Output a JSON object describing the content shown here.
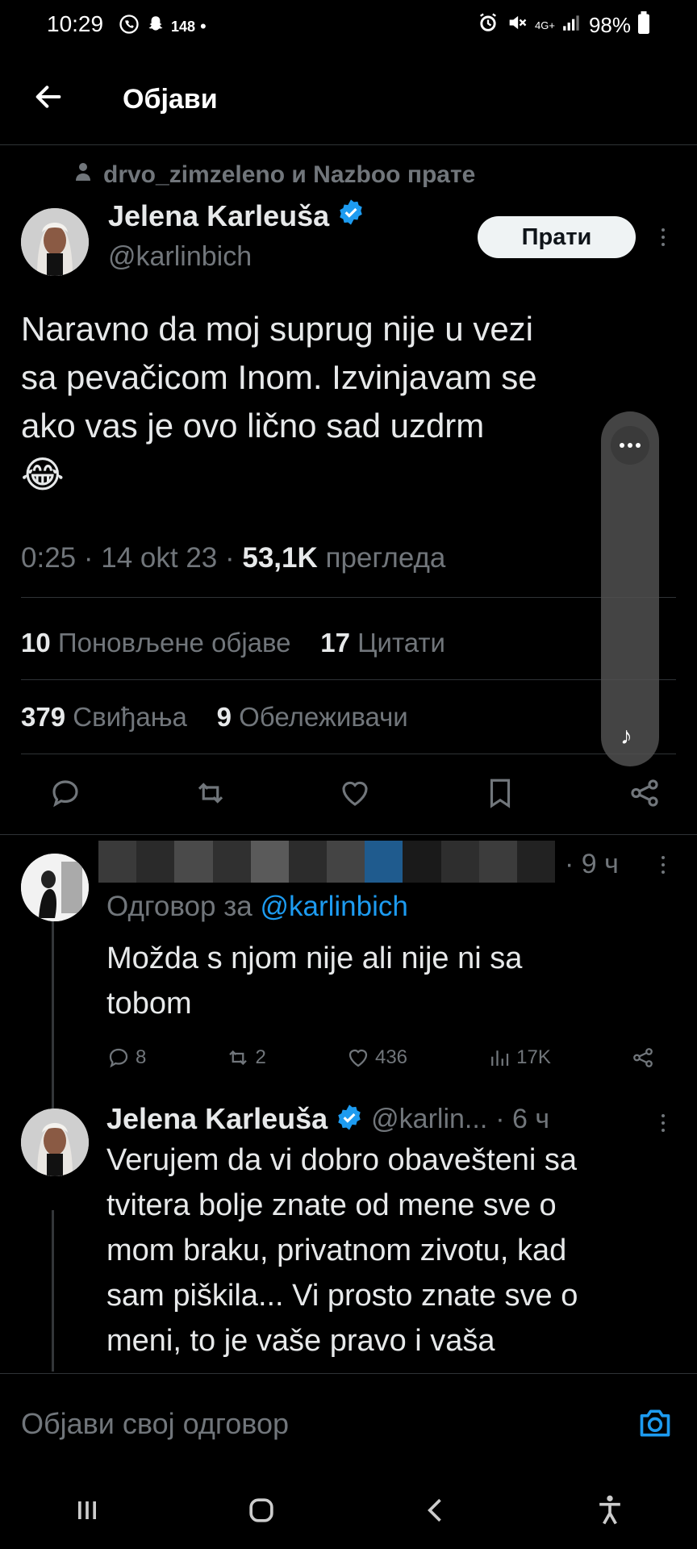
{
  "status_bar": {
    "time": "10:29",
    "notif_count": "148",
    "signal_label": "4G+",
    "battery": "98%"
  },
  "header": {
    "title": "Објави"
  },
  "tweet": {
    "social_context": "drvo_zimzeleno и Nazboo прате",
    "author_name": "Jelena Karleuša",
    "author_handle": "@karlinbich",
    "follow_label": "Прати",
    "text_lines": [
      "Naravno da moj suprug nije u vezi",
      "sa pevačicom Inom. Izvinjavam se",
      "ako vas je ovo lično sad uzdrm",
      "😂"
    ],
    "time": "0:25",
    "date": "14 okt 23",
    "views_count": "53,1K",
    "views_label": "прегледа",
    "reposts_count": "10",
    "reposts_label": "Поновљене објаве",
    "quotes_count": "17",
    "quotes_label": "Цитати",
    "likes_count": "379",
    "likes_label": "Свиђања",
    "bookmarks_count": "9",
    "bookmarks_label": "Обележивачи"
  },
  "reply1": {
    "time_ago": "· 9 ч",
    "reply_to_label": "Одговор за",
    "reply_to_handle": "@karlinbich",
    "text_lines": [
      "Možda s njom nije ali nije ni sa",
      "tobom"
    ],
    "replies": "8",
    "reposts": "2",
    "likes": "436",
    "views": "17K"
  },
  "reply2": {
    "author_name": "Jelena Karleuša",
    "author_handle": "@karlin...",
    "time_ago": "· 6 ч",
    "text_lines": [
      "Verujem da vi dobro obavešteni sa",
      "tvitera bolje znate od mene sve o",
      "mom braku, privatnom zivotu, kad",
      "sam piškila... Vi prosto znate sve o",
      "meni, to je vaše pravo i vaša"
    ]
  },
  "compose": {
    "placeholder": "Објави свој одговор"
  },
  "colors": {
    "accent": "#1d9bf0",
    "muted": "#71767b",
    "text": "#e7e9ea",
    "background": "#000000"
  }
}
